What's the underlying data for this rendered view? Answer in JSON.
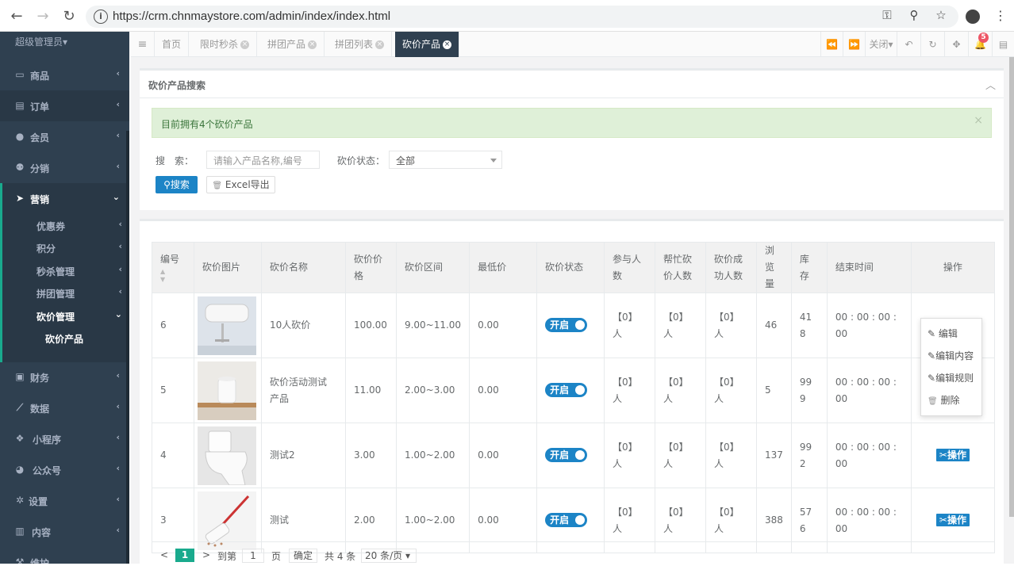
{
  "browser": {
    "url": "https://crm.chnmaystore.com/admin/index/index.html"
  },
  "sidebar": {
    "admin_label": "超级管理员▾",
    "items": [
      {
        "label": "商品",
        "icon": "monitor-icon"
      },
      {
        "label": "订单",
        "icon": "document-icon"
      },
      {
        "label": "会员",
        "icon": "user-icon"
      },
      {
        "label": "分销",
        "icon": "users-icon"
      },
      {
        "label": "营销",
        "icon": "send-icon"
      },
      {
        "label": "财务",
        "icon": "money-icon"
      },
      {
        "label": "数据",
        "icon": "chart-icon"
      },
      {
        "label": "小程序",
        "icon": "cubes-icon"
      },
      {
        "label": "公众号",
        "icon": "wechat-icon"
      },
      {
        "label": "设置",
        "icon": "gear-icon"
      },
      {
        "label": "内容",
        "icon": "book-icon"
      },
      {
        "label": "维护",
        "icon": "wrench-icon"
      }
    ],
    "sub_items": [
      "优惠券",
      "积分",
      "秒杀管理",
      "拼团管理",
      "砍价管理"
    ],
    "sub_sub_item": "砍价产品"
  },
  "tabs": {
    "items": [
      "首页",
      "限时秒杀",
      "拼团产品",
      "拼团列表",
      "砍价产品"
    ],
    "close_label": "关闭",
    "notif_count": "5"
  },
  "search_panel": {
    "title": "砍价产品搜索",
    "alert": "目前拥有4个砍价产品",
    "search_label": "搜　索：",
    "search_placeholder": "请输入产品名称,编号",
    "status_label": "砍价状态：",
    "status_value": "全部",
    "search_button": "搜索",
    "excel_button": "Excel导出"
  },
  "table": {
    "headers": [
      "编号",
      "砍价图片",
      "砍价名称",
      "砍价价格",
      "砍价区间",
      "最低价",
      "砍价状态",
      "参与人数",
      "帮忙砍价人数",
      "砍价成功人数",
      "浏览量",
      "库存",
      "结束时间",
      "操作"
    ],
    "header_lines": [
      [
        "编号"
      ],
      [
        "砍价图片"
      ],
      [
        "砍价名称"
      ],
      [
        "砍价价",
        "格"
      ],
      [
        "砍价区间"
      ],
      [
        "最低价"
      ],
      [
        "砍价状态"
      ],
      [
        "参与人",
        "数"
      ],
      [
        "帮忙砍",
        "价人数"
      ],
      [
        "砍价成",
        "功人数"
      ],
      [
        "浏览",
        "量"
      ],
      [
        "库",
        "存"
      ],
      [
        "结束时间"
      ],
      [
        "操作"
      ]
    ],
    "rows": [
      {
        "id": "6",
        "name1": "10人砍价",
        "name2": "",
        "price": "100.00",
        "range": "9.00~11.00",
        "min": "0.00",
        "status": "开启",
        "p1": "【0】",
        "p2": "人",
        "h1": "【0】",
        "h2": "人",
        "s1": "【0】",
        "s2": "人",
        "views": "46",
        "stock1": "41",
        "stock2": "8",
        "end1": "00 : 00 : 00 :",
        "end2": "00",
        "op": ""
      },
      {
        "id": "5",
        "name1": "砍价活动测试",
        "name2": "产品",
        "price": "11.00",
        "range": "2.00~3.00",
        "min": "0.00",
        "status": "开启",
        "p1": "【0】",
        "p2": "人",
        "h1": "【0】",
        "h2": "人",
        "s1": "【0】",
        "s2": "人",
        "views": "5",
        "stock1": "99",
        "stock2": "9",
        "end1": "00 : 00 : 00 :",
        "end2": "00",
        "op": ""
      },
      {
        "id": "4",
        "name1": "测试2",
        "name2": "",
        "price": "3.00",
        "range": "1.00~2.00",
        "min": "0.00",
        "status": "开启",
        "p1": "【0】",
        "p2": "人",
        "h1": "【0】",
        "h2": "人",
        "s1": "【0】",
        "s2": "人",
        "views": "137",
        "stock1": "99",
        "stock2": "2",
        "end1": "00 : 00 : 00 :",
        "end2": "00",
        "op": "操作"
      },
      {
        "id": "3",
        "name1": "测试",
        "name2": "",
        "price": "2.00",
        "range": "1.00~2.00",
        "min": "0.00",
        "status": "开启",
        "p1": "【0】",
        "p2": "人",
        "h1": "【0】",
        "h2": "人",
        "s1": "【0】",
        "s2": "人",
        "views": "388",
        "stock1": "57",
        "stock2": "6",
        "end1": "00 : 00 : 00 :",
        "end2": "00",
        "op": "操作"
      }
    ],
    "op_open_label": "操作",
    "dropdown": [
      "编辑",
      "编辑内容",
      "编辑规则",
      "删除"
    ]
  },
  "pager": {
    "prev": "<",
    "current": "1",
    "next": ">",
    "goto": "到第",
    "page_input": "1",
    "page": "页",
    "confirm": "确定",
    "total": "共 4 条",
    "per_page": "20 条/页"
  }
}
